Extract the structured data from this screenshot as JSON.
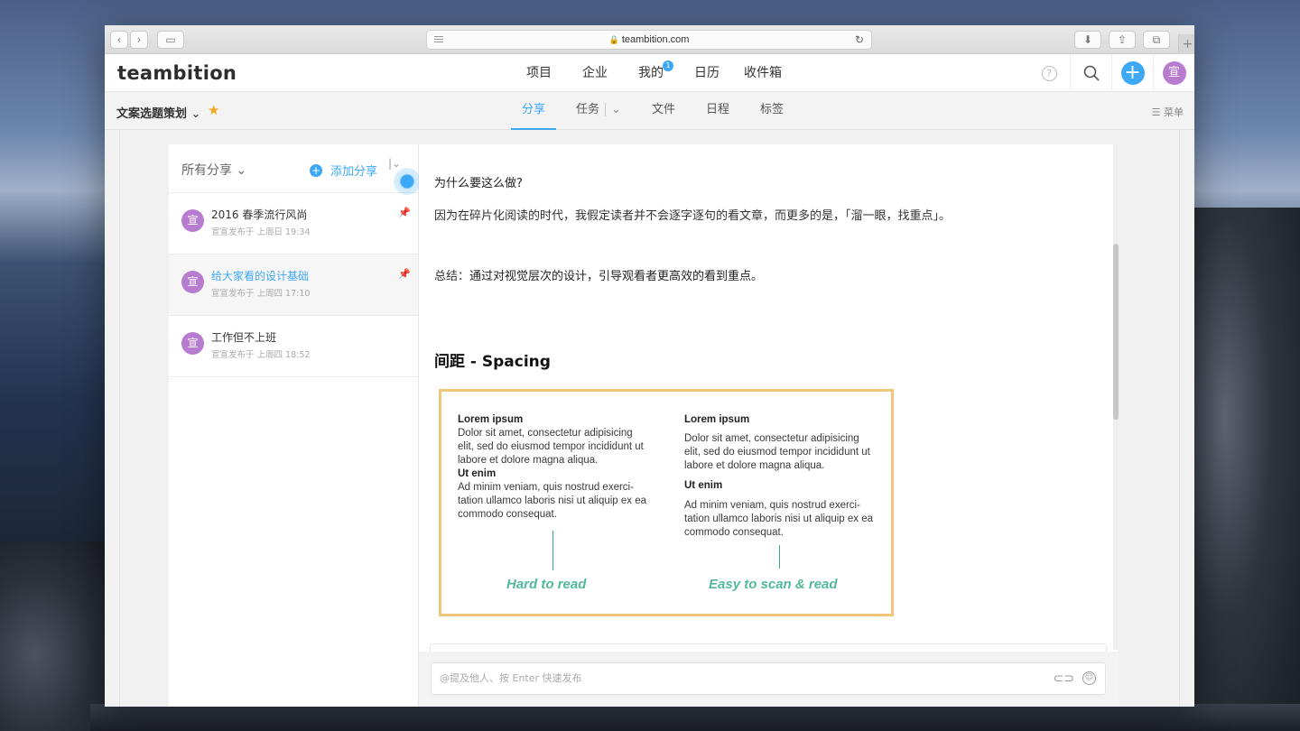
{
  "browser": {
    "url": "teambition.com"
  },
  "app": {
    "logo": "teambition",
    "nav": [
      {
        "label": "项目"
      },
      {
        "label": "企业"
      },
      {
        "label": "我的",
        "badge": "1"
      },
      {
        "label": "日历"
      },
      {
        "label": "收件箱"
      }
    ],
    "help_glyph": "?",
    "avatar_text": "宣"
  },
  "project": {
    "name": "文案选题策划",
    "tabs": [
      "分享",
      "任务",
      "文件",
      "日程",
      "标签"
    ],
    "active_tab": "分享",
    "menu_label": "菜单"
  },
  "shares": {
    "filter_label": "所有分享",
    "add_label": "添加分享",
    "items": [
      {
        "title": "2016 春季流行风尚",
        "meta": "宣宣发布于 上周日 19:34",
        "avatar": "宣",
        "selected": false
      },
      {
        "title": "给大家看的设计基础",
        "meta": "宣宣发布于 上周四 17:10",
        "avatar": "宣",
        "selected": true
      },
      {
        "title": "工作但不上班",
        "meta": "宣宣发布于 上周四 18:52",
        "avatar": "宣",
        "selected": false
      }
    ]
  },
  "article": {
    "q": "为什么要这么做?",
    "reason": "因为在碎片化阅读的时代，我假定读者并不会逐字逐句的看文章，而更多的是，「溜一眼，找重点」。",
    "summary_label": "总结：",
    "summary_text": "通过对视觉层次的设计，引导观看者更高效的看到重点。",
    "heading": "间距 - Spacing",
    "figure": {
      "left": {
        "h1": "Lorem ipsum",
        "p1": "Dolor sit amet, consectetur adipisicing elit, sed do eiusmod tempor incididunt ut labore et dolore magna aliqua.",
        "h2": "Ut enim",
        "p2": "Ad minim veniam, quis nostrud exerci-tation ullamco laboris nisi ut aliquip ex ea commodo consequat.",
        "caption": "Hard to read"
      },
      "right": {
        "h1": "Lorem ipsum",
        "p1": "Dolor sit amet, consectetur adipisicing elit, sed do eiusmod tempor incididunt ut labore et dolore magna aliqua.",
        "h2": "Ut enim",
        "p2": "Ad minim veniam, quis nostrud exerci-tation ullamco laboris nisi ut aliquip ex ea commodo consequat.",
        "caption": "Easy to scan & read"
      }
    }
  },
  "composer": {
    "placeholder": "@提及他人、按 Enter 快速发布"
  },
  "colors": {
    "accent": "#3da8f5",
    "avatar": "#b77bd0",
    "star": "#f5a623",
    "figure_border": "#f0c77a",
    "caption_green": "#52b89b"
  },
  "icons": [
    "back-icon",
    "forward-icon",
    "sidebar-icon",
    "lock-icon",
    "reload-icon",
    "download-icon",
    "share-icon",
    "tabs-icon",
    "help-icon",
    "search-icon",
    "plus-icon",
    "star-icon",
    "menu-icon",
    "chevron-down-icon",
    "pin-icon",
    "attach-icon",
    "emoji-icon"
  ]
}
